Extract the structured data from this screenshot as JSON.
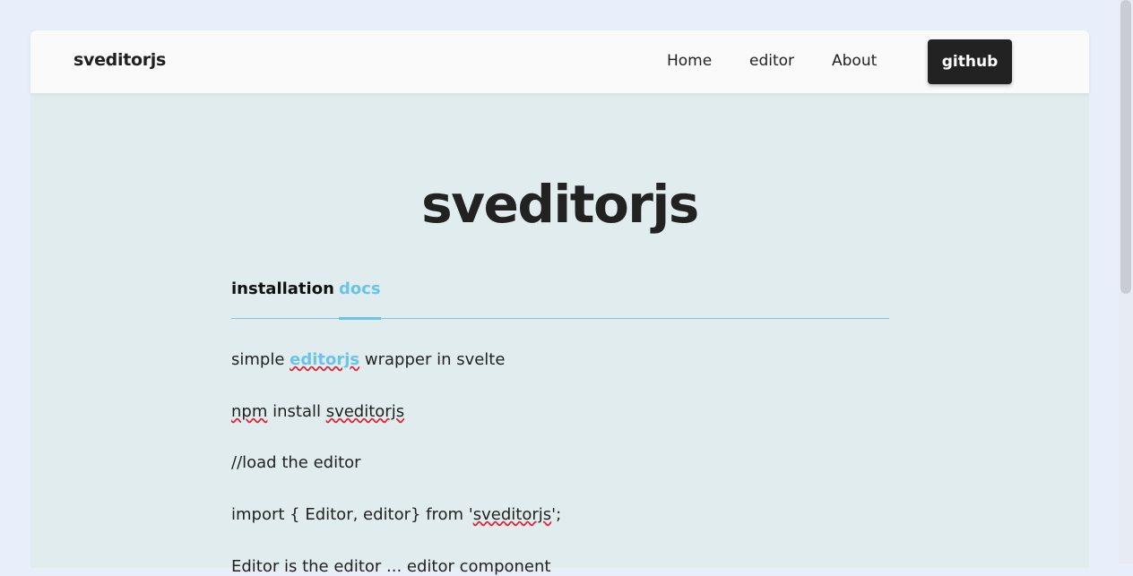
{
  "navbar": {
    "brand": "sveditorjs",
    "links": [
      "Home",
      "editor",
      "About"
    ],
    "github_label": "github"
  },
  "main": {
    "title": "sveditorjs",
    "tabs": [
      {
        "label": "installation",
        "active": false
      },
      {
        "label": "docs",
        "active": true
      }
    ],
    "content": {
      "line1_prefix": "simple ",
      "line1_link": "editorjs",
      "line1_suffix": " wrapper in svelte",
      "line2_a": "npm",
      "line2_b": " install ",
      "line2_c": "sveditorjs",
      "line3": "//load the editor",
      "line4_prefix": "import { Editor, editor} from '",
      "line4_pkg": "sveditorjs",
      "line4_suffix": "';",
      "line5": "Editor              is the editor ... editor component"
    }
  },
  "colors": {
    "accent": "#6cc3e8",
    "nav_bg": "#fafafa",
    "page_bg": "#e1ecee",
    "button_bg": "#222222"
  }
}
